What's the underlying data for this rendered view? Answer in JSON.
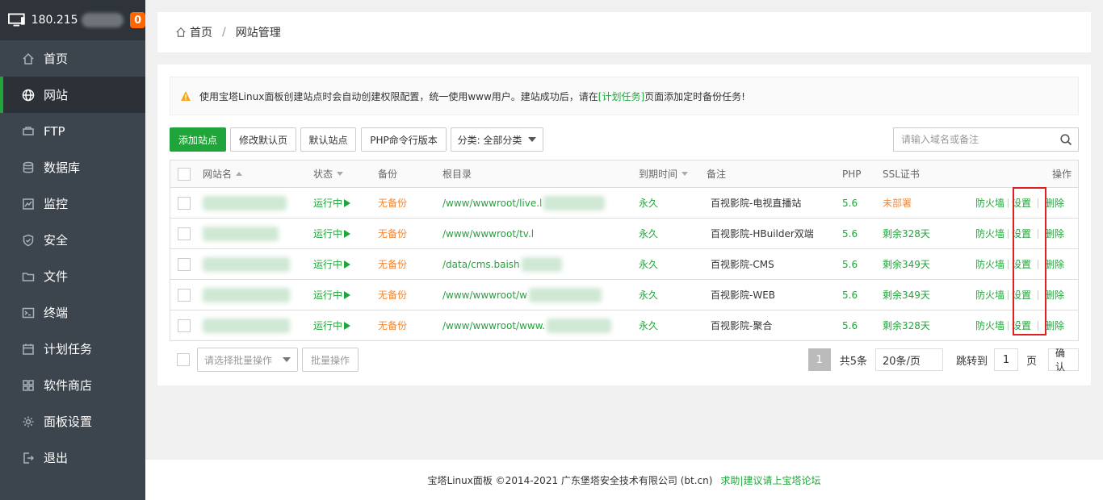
{
  "sidebar": {
    "ip": "180.215",
    "badge": "0",
    "items": [
      {
        "label": "首页",
        "icon": "home-icon"
      },
      {
        "label": "网站",
        "icon": "globe-icon",
        "active": true
      },
      {
        "label": "FTP",
        "icon": "ftp-icon"
      },
      {
        "label": "数据库",
        "icon": "database-icon"
      },
      {
        "label": "监控",
        "icon": "monitor-icon"
      },
      {
        "label": "安全",
        "icon": "shield-icon"
      },
      {
        "label": "文件",
        "icon": "folder-icon"
      },
      {
        "label": "终端",
        "icon": "terminal-icon"
      },
      {
        "label": "计划任务",
        "icon": "calendar-icon"
      },
      {
        "label": "软件商店",
        "icon": "grid-icon"
      },
      {
        "label": "面板设置",
        "icon": "gear-icon"
      },
      {
        "label": "退出",
        "icon": "logout-icon"
      }
    ]
  },
  "breadcrumb": {
    "home": "首页",
    "sep": "/",
    "current": "网站管理"
  },
  "notice": {
    "before": "使用宝塔Linux面板创建站点时会自动创建权限配置，统一使用www用户。建站成功后，请在",
    "link": "[计划任务]",
    "after": "页面添加定时备份任务!"
  },
  "toolbar": {
    "add_site": "添加站点",
    "modify_default_page": "修改默认页",
    "default_site": "默认站点",
    "php_cli": "PHP命令行版本",
    "category": "分类: 全部分类",
    "search_placeholder": "请输入域名或备注"
  },
  "table": {
    "headers": {
      "name": "网站名",
      "status": "状态",
      "backup": "备份",
      "root": "根目录",
      "expire": "到期时间",
      "remark": "备注",
      "php": "PHP",
      "ssl": "SSL证书",
      "ops": "操作"
    },
    "rows": [
      {
        "status": "运行中",
        "backup": "无备份",
        "root": "/www/wwwroot/live.l",
        "expire": "永久",
        "remark": "百视影院-电视直播站",
        "php": "5.6",
        "ssl": "未部署",
        "ssl_ok": false,
        "firewall": "防火墙",
        "settings": "设置",
        "delete": "删除"
      },
      {
        "status": "运行中",
        "backup": "无备份",
        "root": "/www/wwwroot/tv.l",
        "expire": "永久",
        "remark": "百视影院-HBuilder双端",
        "php": "5.6",
        "ssl": "剩余328天",
        "ssl_ok": true,
        "firewall": "防火墙",
        "settings": "设置",
        "delete": "删除"
      },
      {
        "status": "运行中",
        "backup": "无备份",
        "root": "/data/cms.baish",
        "expire": "永久",
        "remark": "百视影院-CMS",
        "php": "5.6",
        "ssl": "剩余349天",
        "ssl_ok": true,
        "firewall": "防火墙",
        "settings": "设置",
        "delete": "删除"
      },
      {
        "status": "运行中",
        "backup": "无备份",
        "root": "/www/wwwroot/w",
        "expire": "永久",
        "remark": "百视影院-WEB",
        "php": "5.6",
        "ssl": "剩余349天",
        "ssl_ok": true,
        "firewall": "防火墙",
        "settings": "设置",
        "delete": "删除"
      },
      {
        "status": "运行中",
        "backup": "无备份",
        "root": "/www/wwwroot/www.",
        "expire": "永久",
        "remark": "百视影院-聚合",
        "php": "5.6",
        "ssl": "剩余328天",
        "ssl_ok": true,
        "firewall": "防火墙",
        "settings": "设置",
        "delete": "删除"
      }
    ]
  },
  "batch": {
    "placeholder": "请选择批量操作",
    "button": "批量操作"
  },
  "pagination": {
    "page": "1",
    "total": "共5条",
    "per_page": "20条/页",
    "jump": "跳转到",
    "jump_value": "1",
    "page_unit": "页",
    "confirm": "确认"
  },
  "footer": {
    "copyright": "宝塔Linux面板 ©2014-2021 广东堡塔安全技术有限公司 (bt.cn)",
    "link": "求助|建议请上宝塔论坛"
  },
  "colors": {
    "accent": "#20a53a",
    "sidebar": "#3c444d",
    "warning": "#f0883a",
    "highlight": "#e02020"
  }
}
